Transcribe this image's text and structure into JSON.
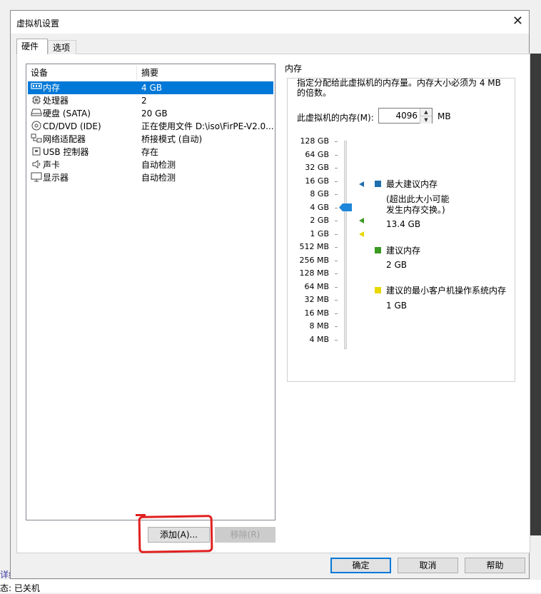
{
  "window": {
    "title": "虚拟机设置"
  },
  "tabs": [
    {
      "label": "硬件"
    },
    {
      "label": "选项"
    }
  ],
  "device_list": {
    "columns": [
      "设备",
      "摘要"
    ],
    "rows": [
      {
        "icon": "memory-icon",
        "name": "内存",
        "summary": "4 GB",
        "selected": true
      },
      {
        "icon": "processor-icon",
        "name": "处理器",
        "summary": "2"
      },
      {
        "icon": "harddisk-icon",
        "name": "硬盘 (SATA)",
        "summary": "20 GB"
      },
      {
        "icon": "cd-dvd-icon",
        "name": "CD/DVD (IDE)",
        "summary": "正在使用文件 D:\\iso\\FirPE-V2.0..."
      },
      {
        "icon": "network-icon",
        "name": "网络适配器",
        "summary": "桥接模式 (自动)"
      },
      {
        "icon": "usb-icon",
        "name": "USB 控制器",
        "summary": "存在"
      },
      {
        "icon": "sound-icon",
        "name": "声卡",
        "summary": "自动检测"
      },
      {
        "icon": "display-icon",
        "name": "显示器",
        "summary": "自动检测"
      }
    ]
  },
  "buttons": {
    "add": "添加(A)...",
    "remove": "移除(R)",
    "ok": "确定",
    "cancel": "取消",
    "help": "帮助"
  },
  "memory": {
    "group_title": "内存",
    "description_line1": "指定分配给此虚拟机的内存量。内存大小必须为 4 MB",
    "description_line2": "的倍数。",
    "field_label": "此虚拟机的内存(M):",
    "value": "4096",
    "unit": "MB",
    "scale": [
      "128 GB",
      "64 GB",
      "32 GB",
      "16 GB",
      "8 GB",
      "4 GB",
      "2 GB",
      "1 GB",
      "512 MB",
      "256 MB",
      "128 MB",
      "64 MB",
      "32 MB",
      "16 MB",
      "8 MB",
      "4 MB"
    ],
    "current_level": "4 GB",
    "legend": {
      "max_title": "最大建议内存",
      "max_note_line1": "(超出此大小可能",
      "max_note_line2": "发生内存交换。)",
      "max_value": "13.4 GB",
      "rec_title": "建议内存",
      "rec_value": "2 GB",
      "min_title": "建议的最小客户机操作系统内存",
      "min_value": "1 GB"
    },
    "colors": {
      "max": "#1e6fb0",
      "rec": "#3a9a22",
      "min": "#e8d800",
      "thumb": "#1e86d8"
    }
  },
  "background": {
    "text1": "详细",
    "text2": "态: 已关机"
  }
}
